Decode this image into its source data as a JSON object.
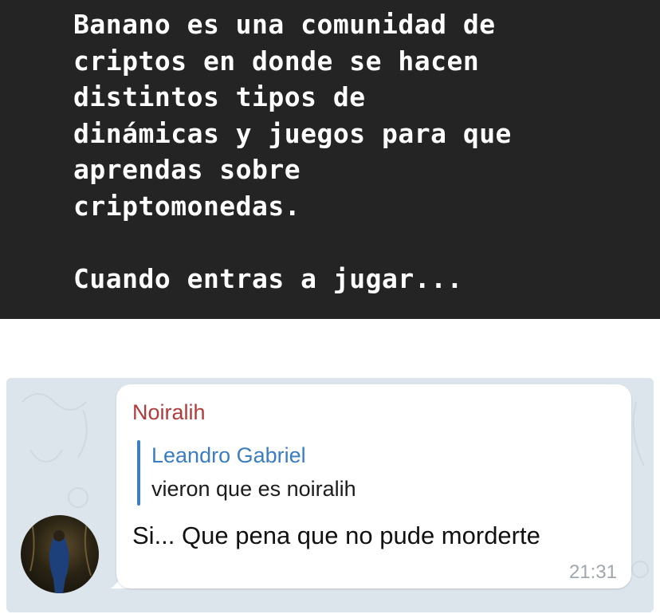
{
  "caption": {
    "lines": [
      "Banano es una comunidad de",
      "criptos en donde se hacen",
      "distintos tipos de",
      "dinámicas y juegos para que",
      "aprendas sobre",
      "criptomonedas.",
      "",
      "Cuando entras a jugar..."
    ]
  },
  "chat": {
    "sender": "Noiralih",
    "reply": {
      "author": "Leandro Gabriel",
      "text": "vieron que es noiralih"
    },
    "message": "Si... Que pena que no pude morderte",
    "time": "21:31",
    "colors": {
      "sender": "#b23a3a",
      "reply_author": "#3a7dc0",
      "reply_bar": "#3b7fc4",
      "background": "#dde5ec"
    }
  }
}
